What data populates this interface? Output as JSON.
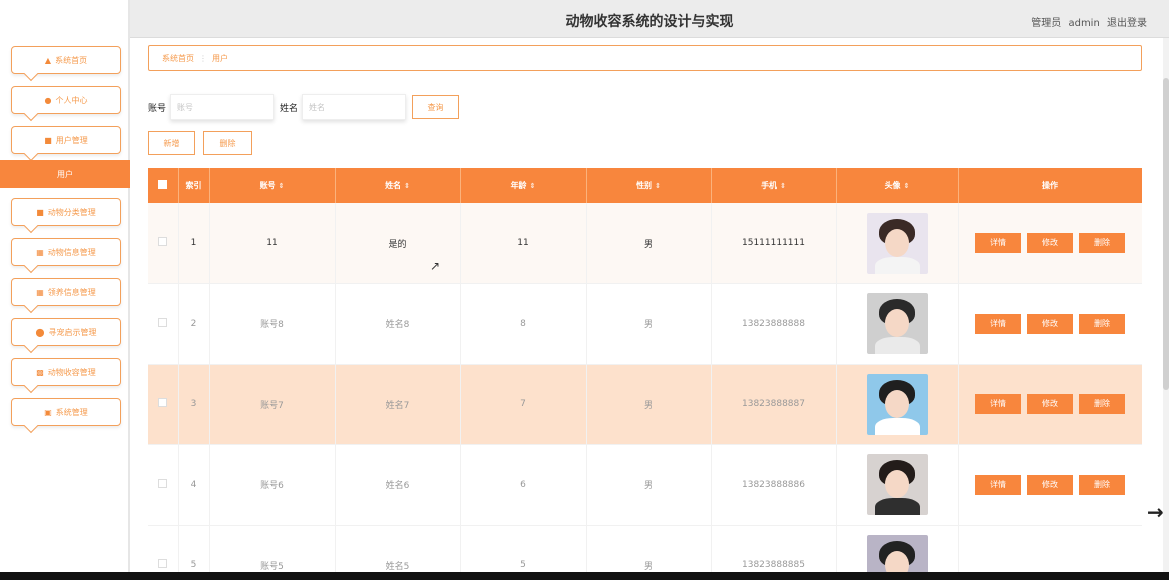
{
  "header": {
    "title": "动物收容系统的设计与实现",
    "role": "管理员",
    "user": "admin",
    "logout": "退出登录"
  },
  "sidebar": {
    "items": [
      {
        "label": "系统首页",
        "icon": "home-icon"
      },
      {
        "label": "个人中心",
        "icon": "user-icon"
      },
      {
        "label": "用户管理",
        "icon": "folder-icon"
      },
      {
        "label": "动物分类管理",
        "icon": "folder-icon"
      },
      {
        "label": "动物信息管理",
        "icon": "grid-icon"
      },
      {
        "label": "领养信息管理",
        "icon": "grid-icon"
      },
      {
        "label": "寻宠启示管理",
        "icon": "drop-icon"
      },
      {
        "label": "动物收容管理",
        "icon": "ticket-icon"
      },
      {
        "label": "系统管理",
        "icon": "briefcase-icon"
      }
    ],
    "active_sub": "用户"
  },
  "breadcrumb": {
    "home": "系统首页",
    "current": "用户"
  },
  "search": {
    "account_label": "账号",
    "account_placeholder": "账号",
    "name_label": "姓名",
    "name_placeholder": "姓名",
    "query_button": "查询"
  },
  "actions": {
    "add": "新增",
    "delete": "删除"
  },
  "table": {
    "headers": [
      "索引",
      "账号",
      "姓名",
      "年龄",
      "性别",
      "手机",
      "头像",
      "操作"
    ],
    "rows": [
      {
        "index": "1",
        "account": "11",
        "name": "是的",
        "age": "11",
        "gender": "男",
        "phone": "15111111111"
      },
      {
        "index": "2",
        "account": "账号8",
        "name": "姓名8",
        "age": "8",
        "gender": "男",
        "phone": "13823888888"
      },
      {
        "index": "3",
        "account": "账号7",
        "name": "姓名7",
        "age": "7",
        "gender": "男",
        "phone": "13823888887"
      },
      {
        "index": "4",
        "account": "账号6",
        "name": "姓名6",
        "age": "6",
        "gender": "男",
        "phone": "13823888886"
      },
      {
        "index": "5",
        "account": "账号5",
        "name": "姓名5",
        "age": "5",
        "gender": "男",
        "phone": "13823888885"
      }
    ],
    "row_actions": {
      "detail": "详情",
      "edit": "修改",
      "delete": "删除"
    }
  },
  "colors": {
    "accent": "#f8863d",
    "accent_light": "#fde1cc"
  }
}
